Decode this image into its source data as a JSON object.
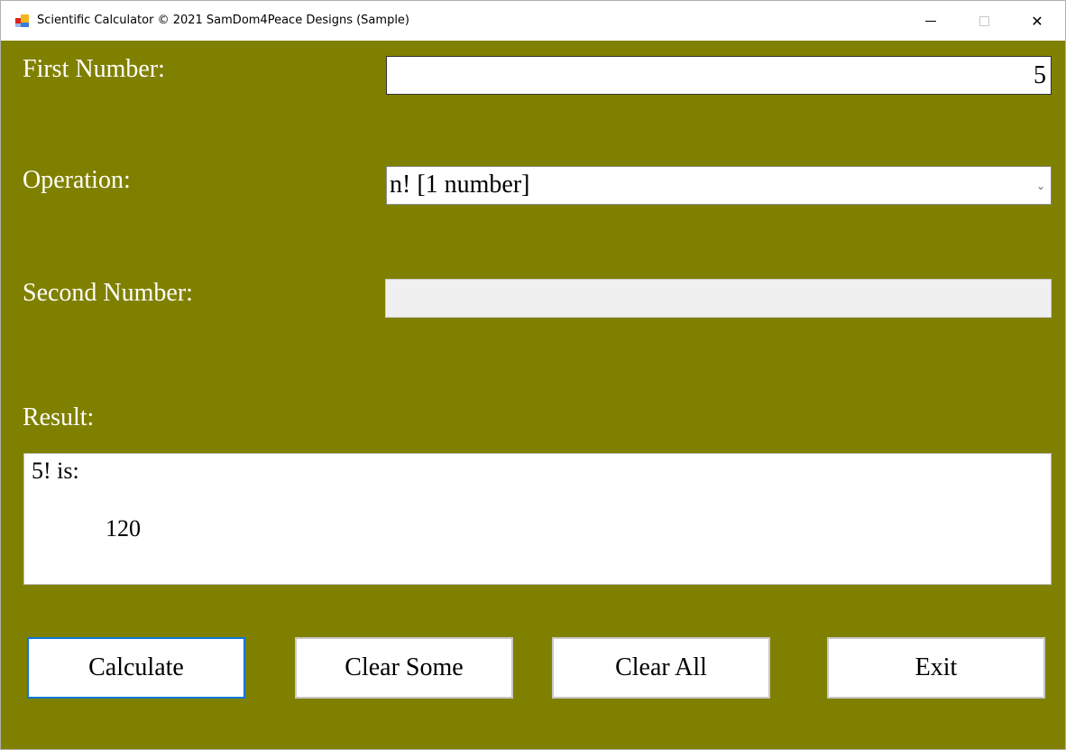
{
  "window": {
    "title": "Scientific Calculator © 2021 SamDom4Peace Designs (Sample)",
    "icon": "app-icon",
    "controls": {
      "minimize": "minimize-icon",
      "maximize": "maximize-icon",
      "close": "close-icon",
      "close_glyph": "✕"
    }
  },
  "form": {
    "first_number_label": "First Number:",
    "first_number_value": "5",
    "operation_label": "Operation:",
    "operation_selected": "n! [1 number]",
    "operation_chevron": "⌄",
    "second_number_label": "Second Number:",
    "second_number_value": "",
    "second_number_enabled": false,
    "result_label": "Result:",
    "result_line1": "5! is:",
    "result_line2": "120"
  },
  "buttons": {
    "calculate": "Calculate",
    "clear_some": "Clear Some",
    "clear_all": "Clear All",
    "exit": "Exit"
  },
  "colors": {
    "background": "#808000",
    "focus_border": "#0a78d7",
    "label_text": "#ffffff"
  }
}
